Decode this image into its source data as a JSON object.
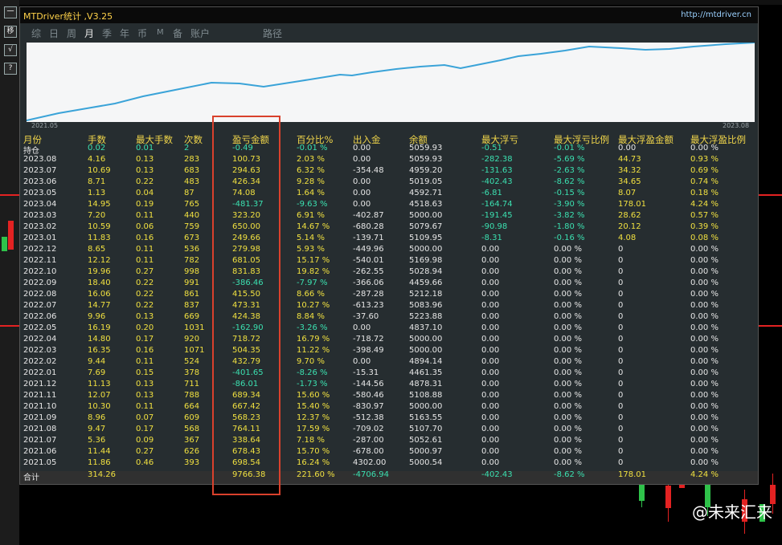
{
  "window": {
    "title": "MTDriver统计 ,V3.25",
    "site": "http://mtdriver.cn"
  },
  "toolbar": [
    "一",
    "移",
    "√",
    "?"
  ],
  "tabs": [
    "综",
    "日",
    "周",
    "月",
    "季",
    "年",
    "币",
    "M",
    "备",
    "账户",
    "路径"
  ],
  "active_tab": "月",
  "equity_chart": {
    "start_label": "2021.05",
    "end_label": "2023.08",
    "line_color": "#3aa3d8"
  },
  "table": {
    "headers": [
      "月份",
      "手数",
      "最大手数",
      "次数",
      "盈亏金额",
      "百分比%",
      "出入金",
      "余额",
      "最大浮亏",
      "最大浮亏比例",
      "最大浮盈金额",
      "最大浮盈比例"
    ],
    "rows": [
      [
        "持仓",
        "0.02",
        "0.01",
        "2",
        "-0.49",
        "-0.01 %",
        "0.00",
        "5059.93",
        "-0.51",
        "-0.01 %",
        "0.00",
        "0.00 %"
      ],
      [
        "2023.08",
        "4.16",
        "0.13",
        "283",
        "100.73",
        "2.03 %",
        "0.00",
        "5059.93",
        "-282.38",
        "-5.69 %",
        "44.73",
        "0.93 %"
      ],
      [
        "2023.07",
        "10.69",
        "0.13",
        "683",
        "294.63",
        "6.32 %",
        "-354.48",
        "4959.20",
        "-131.63",
        "-2.63 %",
        "34.32",
        "0.69 %"
      ],
      [
        "2023.06",
        "8.71",
        "0.22",
        "483",
        "426.34",
        "9.28 %",
        "0.00",
        "5019.05",
        "-402.43",
        "-8.62 %",
        "34.65",
        "0.74 %"
      ],
      [
        "2023.05",
        "1.13",
        "0.04",
        "87",
        "74.08",
        "1.64 %",
        "0.00",
        "4592.71",
        "-6.81",
        "-0.15 %",
        "8.07",
        "0.18 %"
      ],
      [
        "2023.04",
        "14.95",
        "0.19",
        "765",
        "-481.37",
        "-9.63 %",
        "0.00",
        "4518.63",
        "-164.74",
        "-3.90 %",
        "178.01",
        "4.24 %"
      ],
      [
        "2023.03",
        "7.20",
        "0.11",
        "440",
        "323.20",
        "6.91 %",
        "-402.87",
        "5000.00",
        "-191.45",
        "-3.82 %",
        "28.62",
        "0.57 %"
      ],
      [
        "2023.02",
        "10.59",
        "0.06",
        "759",
        "650.00",
        "14.67 %",
        "-680.28",
        "5079.67",
        "-90.98",
        "-1.80 %",
        "20.12",
        "0.39 %"
      ],
      [
        "2023.01",
        "11.83",
        "0.16",
        "673",
        "249.66",
        "5.14 %",
        "-139.71",
        "5109.95",
        "-8.31",
        "-0.16 %",
        "4.08",
        "0.08 %"
      ],
      [
        "2022.12",
        "8.65",
        "0.11",
        "536",
        "279.98",
        "5.93 %",
        "-449.96",
        "5000.00",
        "0.00",
        "0.00 %",
        "0",
        "0.00 %"
      ],
      [
        "2022.11",
        "12.12",
        "0.11",
        "782",
        "681.05",
        "15.17 %",
        "-540.01",
        "5169.98",
        "0.00",
        "0.00 %",
        "0",
        "0.00 %"
      ],
      [
        "2022.10",
        "19.96",
        "0.27",
        "998",
        "831.83",
        "19.82 %",
        "-262.55",
        "5028.94",
        "0.00",
        "0.00 %",
        "0",
        "0.00 %"
      ],
      [
        "2022.09",
        "18.40",
        "0.22",
        "991",
        "-386.46",
        "-7.97 %",
        "-366.06",
        "4459.66",
        "0.00",
        "0.00 %",
        "0",
        "0.00 %"
      ],
      [
        "2022.08",
        "16.06",
        "0.22",
        "861",
        "415.50",
        "8.66 %",
        "-287.28",
        "5212.18",
        "0.00",
        "0.00 %",
        "0",
        "0.00 %"
      ],
      [
        "2022.07",
        "14.77",
        "0.22",
        "837",
        "473.31",
        "10.27 %",
        "-613.23",
        "5083.96",
        "0.00",
        "0.00 %",
        "0",
        "0.00 %"
      ],
      [
        "2022.06",
        "9.96",
        "0.13",
        "669",
        "424.38",
        "8.84 %",
        "-37.60",
        "5223.88",
        "0.00",
        "0.00 %",
        "0",
        "0.00 %"
      ],
      [
        "2022.05",
        "16.19",
        "0.20",
        "1031",
        "-162.90",
        "-3.26 %",
        "0.00",
        "4837.10",
        "0.00",
        "0.00 %",
        "0",
        "0.00 %"
      ],
      [
        "2022.04",
        "14.80",
        "0.17",
        "920",
        "718.72",
        "16.79 %",
        "-718.72",
        "5000.00",
        "0.00",
        "0.00 %",
        "0",
        "0.00 %"
      ],
      [
        "2022.03",
        "16.35",
        "0.16",
        "1071",
        "504.35",
        "11.22 %",
        "-398.49",
        "5000.00",
        "0.00",
        "0.00 %",
        "0",
        "0.00 %"
      ],
      [
        "2022.02",
        "9.44",
        "0.11",
        "524",
        "432.79",
        "9.70 %",
        "0.00",
        "4894.14",
        "0.00",
        "0.00 %",
        "0",
        "0.00 %"
      ],
      [
        "2022.01",
        "7.69",
        "0.15",
        "378",
        "-401.65",
        "-8.26 %",
        "-15.31",
        "4461.35",
        "0.00",
        "0.00 %",
        "0",
        "0.00 %"
      ],
      [
        "2021.12",
        "11.13",
        "0.13",
        "711",
        "-86.01",
        "-1.73 %",
        "-144.56",
        "4878.31",
        "0.00",
        "0.00 %",
        "0",
        "0.00 %"
      ],
      [
        "2021.11",
        "12.07",
        "0.13",
        "788",
        "689.34",
        "15.60 %",
        "-580.46",
        "5108.88",
        "0.00",
        "0.00 %",
        "0",
        "0.00 %"
      ],
      [
        "2021.10",
        "10.30",
        "0.11",
        "664",
        "667.42",
        "15.40 %",
        "-830.97",
        "5000.00",
        "0.00",
        "0.00 %",
        "0",
        "0.00 %"
      ],
      [
        "2021.09",
        "8.96",
        "0.07",
        "609",
        "568.23",
        "12.37 %",
        "-512.38",
        "5163.55",
        "0.00",
        "0.00 %",
        "0",
        "0.00 %"
      ],
      [
        "2021.08",
        "9.47",
        "0.17",
        "568",
        "764.11",
        "17.59 %",
        "-709.02",
        "5107.70",
        "0.00",
        "0.00 %",
        "0",
        "0.00 %"
      ],
      [
        "2021.07",
        "5.36",
        "0.09",
        "367",
        "338.64",
        "7.18 %",
        "-287.00",
        "5052.61",
        "0.00",
        "0.00 %",
        "0",
        "0.00 %"
      ],
      [
        "2021.06",
        "11.44",
        "0.27",
        "626",
        "678.43",
        "15.70 %",
        "-678.00",
        "5000.97",
        "0.00",
        "0.00 %",
        "0",
        "0.00 %"
      ],
      [
        "2021.05",
        "11.86",
        "0.46",
        "393",
        "698.54",
        "16.24 %",
        "4302.00",
        "5000.54",
        "0.00",
        "0.00 %",
        "0",
        "0.00 %"
      ]
    ],
    "summary": [
      "合计",
      "314.26",
      "",
      "",
      "9766.38",
      "221.60 %",
      "-4706.94",
      "",
      "-402.43",
      "-8.62 %",
      "178.01",
      "4.24 %"
    ]
  },
  "watermark": "@未来汇来",
  "colors": {
    "panel_bg": "#262d30",
    "header": "#f0d54a",
    "positive": "#f0e040",
    "negative": "#3be0b0",
    "highlight_box": "#d9412c"
  }
}
